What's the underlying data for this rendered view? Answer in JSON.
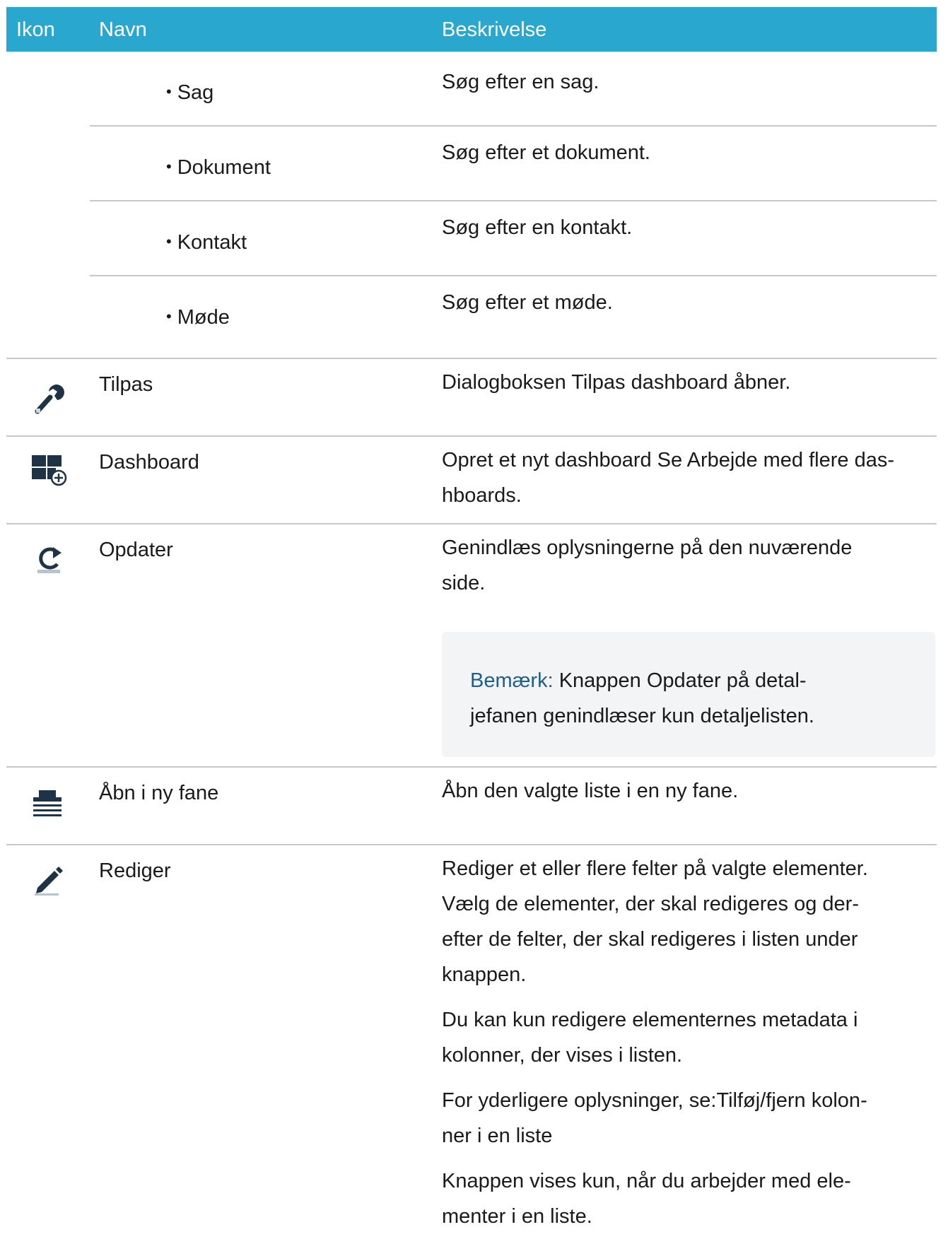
{
  "header": {
    "icon_col": "Ikon",
    "name_col": "Navn",
    "desc_col": "Beskrivelse"
  },
  "search_sub": [
    {
      "label": "Sag",
      "desc": "Søg efter en sag."
    },
    {
      "label": "Dokument",
      "desc": "Søg efter et dokument."
    },
    {
      "label": "Kontakt",
      "desc": "Søg efter en kontakt."
    },
    {
      "label": "Møde",
      "desc": "Søg efter et møde."
    }
  ],
  "rows": {
    "tilpas": {
      "icon": "wrench-icon",
      "name": "Tilpas",
      "desc_pre": "Dialogboksen ",
      "desc_bold": "Tilpas dashboard",
      "desc_post": " åbner."
    },
    "dashboard": {
      "icon": "dashboard-add-icon",
      "name": "Dashboard",
      "desc_line1": "Opret et nyt dashboard Se Arbejde med flere das-",
      "desc_line2": "hboards."
    },
    "opdater": {
      "icon": "refresh-icon",
      "name": "Opdater",
      "desc_line1": "Genindlæs oplysningerne på den nuværende",
      "desc_line2": "side.",
      "note_label": "Bemærk:",
      "note_pre": " Knappen ",
      "note_bold": "Opdater",
      "note_post1": " på detal-",
      "note_line2": "jefanen genindlæser kun detaljelisten."
    },
    "aabn": {
      "icon": "open-new-tab-icon",
      "name": "Åbn i ny fane",
      "desc": "Åbn den valgte liste i en ny fane."
    },
    "rediger": {
      "icon": "pencil-icon",
      "name": "Rediger",
      "p1": [
        "Rediger et eller flere felter på valgte elementer.",
        "Vælg de elementer, der skal redigeres og der-",
        "efter de felter, der skal redigeres i listen under",
        "knappen."
      ],
      "p2": [
        "Du kan kun redigere elementernes metadata i",
        "kolonner, der vises i listen."
      ],
      "p3": [
        "For yderligere oplysninger, se:Tilføj/fjern kolon-",
        "ner i en liste"
      ],
      "p4": [
        "Knappen vises kun, når du arbejder med ele-",
        "menter i en liste."
      ]
    }
  },
  "colors": {
    "header": "#29a7cf",
    "note_label": "#1f5e8c",
    "note_bg": "#f3f4f6"
  }
}
